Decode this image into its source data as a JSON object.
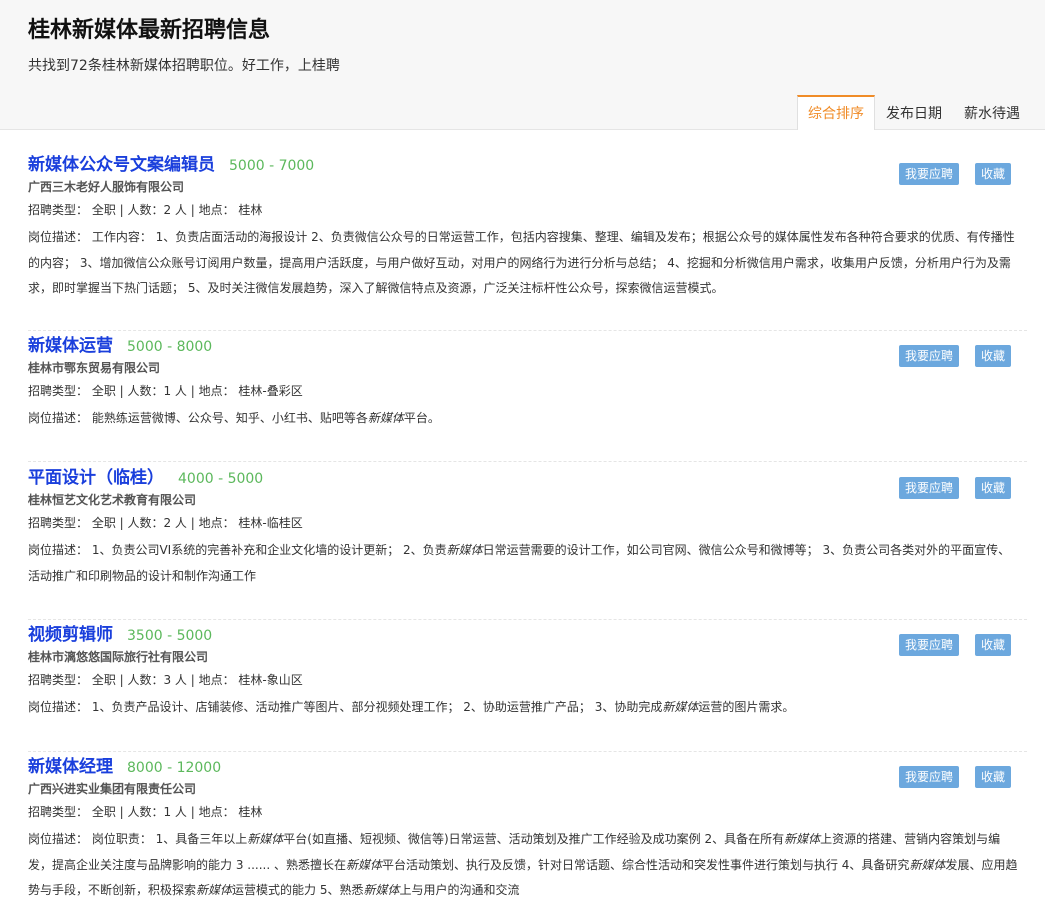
{
  "header": {
    "title": "桂林新媒体最新招聘信息",
    "subtitle": "共找到72条桂林新媒体招聘职位。好工作，上桂聘"
  },
  "sort_tabs": [
    {
      "label": "综合排序",
      "active": true
    },
    {
      "label": "发布日期",
      "active": false
    },
    {
      "label": "薪水待遇",
      "active": false
    }
  ],
  "buttons": {
    "apply": "我要应聘",
    "favorite": "收藏"
  },
  "jobs": [
    {
      "title": "新媒体公众号文案编辑员",
      "salary": "5000 - 7000",
      "company": "广西三木老好人服饰有限公司",
      "meta": "招聘类型： 全职 | 人数：2 人 | 地点： 桂林",
      "description": "岗位描述： 工作内容： 1、负责店面活动的海报设计 2、负责微信公众号的日常运营工作，包括内容搜集、整理、编辑及发布；根据公众号的媒体属性发布各种符合要求的优质、有传播性的内容； 3、增加微信公众账号订阅用户数量，提高用户活跃度，与用户做好互动，对用户的网络行为进行分析与总结； 4、挖掘和分析微信用户需求，收集用户反馈，分析用户行为及需求，即时掌握当下热门话题； 5、及时关注微信发展趋势，深入了解微信特点及资源，广泛关注标杆性公众号，探索微信运营模式。"
    },
    {
      "title": "新媒体运营",
      "salary": "5000 - 8000",
      "company": "桂林市鄂东贸易有限公司",
      "meta": "招聘类型： 全职 | 人数：1 人 | 地点： 桂林-叠彩区",
      "description": "岗位描述： 能熟练运营微博、公众号、知乎、小红书、贴吧等各新媒体平台。"
    },
    {
      "title": "平面设计（临桂）",
      "salary": "4000 - 5000",
      "company": "桂林恒艺文化艺术教育有限公司",
      "meta": "招聘类型： 全职 | 人数：2 人 | 地点： 桂林-临桂区",
      "description": "岗位描述： 1、负责公司VI系统的完善补充和企业文化墙的设计更新； 2、负责新媒体日常运营需要的设计工作，如公司官网、微信公众号和微博等； 3、负责公司各类对外的平面宣传、活动推广和印刷物品的设计和制作沟通工作"
    },
    {
      "title": "视频剪辑师",
      "salary": "3500 - 5000",
      "company": "桂林市漓悠悠国际旅行社有限公司",
      "meta": "招聘类型： 全职 | 人数：3 人 | 地点： 桂林-象山区",
      "description": "岗位描述： 1、负责产品设计、店铺装修、活动推广等图片、部分视频处理工作； 2、协助运营推广产品； 3、协助完成新媒体运营的图片需求。"
    },
    {
      "title": "新媒体经理",
      "salary": "8000 - 12000",
      "company": "广西兴进实业集团有限责任公司",
      "meta": "招聘类型： 全职 | 人数：1 人 | 地点： 桂林",
      "description": "岗位描述： 岗位职责： 1、具备三年以上新媒体平台(如直播、短视频、微信等)日常运营、活动策划及推广工作经验及成功案例 2、具备在所有新媒体上资源的搭建、营销内容策划与编发，提高企业关注度与品牌影响的能力 3 ...... 、熟悉擅长在新媒体平台活动策划、执行及反馈，针对日常话题、综合性活动和突发性事件进行策划与执行 4、具备研究新媒体发展、应用趋势与手段，不断创新，积极探索新媒体运营模式的能力 5、熟悉新媒体上与用户的沟通和交流"
    }
  ]
}
